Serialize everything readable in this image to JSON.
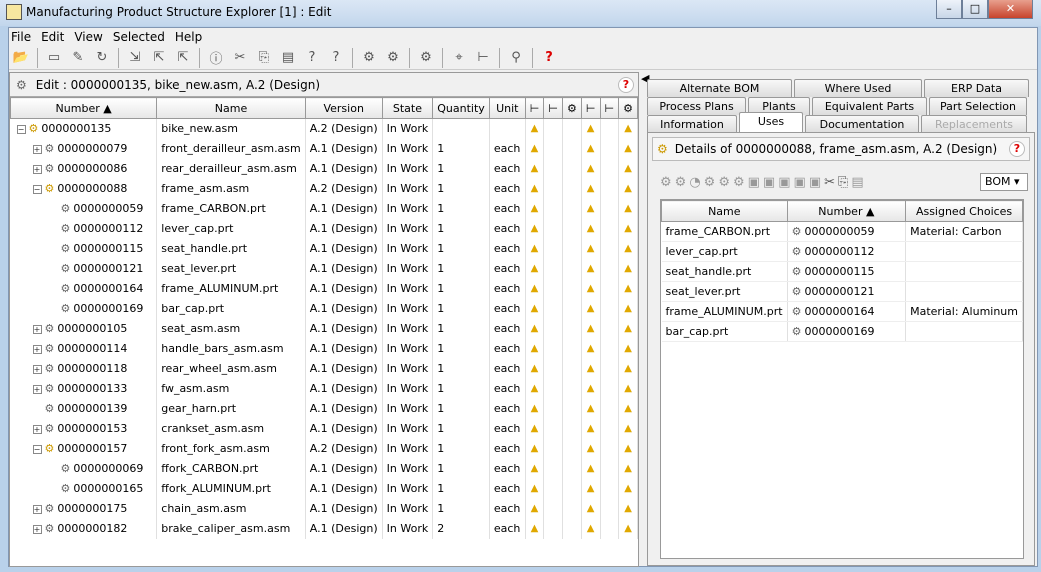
{
  "window": {
    "title": "Manufacturing Product Structure Explorer [1] : Edit"
  },
  "menu": [
    "File",
    "Edit",
    "View",
    "Selected",
    "Help"
  ],
  "toolbar_icons": [
    "open-icon",
    "folder-icon",
    "edit-icon",
    "refresh-icon",
    "check-in-icon",
    "check-out-icon",
    "undo-checkout-icon",
    "info-icon",
    "cut-icon",
    "copy-icon",
    "paste-icon",
    "help-box-icon",
    "help-box-icon",
    "insert-icon",
    "replace-icon",
    "save-icon",
    "select-icon",
    "tree-icon",
    "find-icon",
    "help-icon"
  ],
  "left": {
    "header": "Edit : 0000000135, bike_new.asm, A.2 (Design)",
    "columns": [
      "Number",
      "Name",
      "Version",
      "State",
      "Quantity",
      "Unit"
    ],
    "rows": [
      {
        "level": 0,
        "exp": "-",
        "number": "0000000135",
        "name": "bike_new.asm",
        "version": "A.2 (Design)",
        "state": "In Work",
        "qty": "",
        "unit": ""
      },
      {
        "level": 1,
        "exp": "+",
        "number": "0000000079",
        "name": "front_derailleur_asm.asm",
        "version": "A.1 (Design)",
        "state": "In Work",
        "qty": "1",
        "unit": "each"
      },
      {
        "level": 1,
        "exp": "+",
        "number": "0000000086",
        "name": "rear_derailleur_asm.asm",
        "version": "A.1 (Design)",
        "state": "In Work",
        "qty": "1",
        "unit": "each"
      },
      {
        "level": 1,
        "exp": "-",
        "number": "0000000088",
        "name": "frame_asm.asm",
        "version": "A.2 (Design)",
        "state": "In Work",
        "qty": "1",
        "unit": "each"
      },
      {
        "level": 2,
        "exp": "",
        "number": "0000000059",
        "name": "frame_CARBON.prt",
        "version": "A.1 (Design)",
        "state": "In Work",
        "qty": "1",
        "unit": "each"
      },
      {
        "level": 2,
        "exp": "",
        "number": "0000000112",
        "name": "lever_cap.prt",
        "version": "A.1 (Design)",
        "state": "In Work",
        "qty": "1",
        "unit": "each"
      },
      {
        "level": 2,
        "exp": "",
        "number": "0000000115",
        "name": "seat_handle.prt",
        "version": "A.1 (Design)",
        "state": "In Work",
        "qty": "1",
        "unit": "each"
      },
      {
        "level": 2,
        "exp": "",
        "number": "0000000121",
        "name": "seat_lever.prt",
        "version": "A.1 (Design)",
        "state": "In Work",
        "qty": "1",
        "unit": "each"
      },
      {
        "level": 2,
        "exp": "",
        "number": "0000000164",
        "name": "frame_ALUMINUM.prt",
        "version": "A.1 (Design)",
        "state": "In Work",
        "qty": "1",
        "unit": "each"
      },
      {
        "level": 2,
        "exp": "",
        "number": "0000000169",
        "name": "bar_cap.prt",
        "version": "A.1 (Design)",
        "state": "In Work",
        "qty": "1",
        "unit": "each"
      },
      {
        "level": 1,
        "exp": "+",
        "number": "0000000105",
        "name": "seat_asm.asm",
        "version": "A.1 (Design)",
        "state": "In Work",
        "qty": "1",
        "unit": "each"
      },
      {
        "level": 1,
        "exp": "+",
        "number": "0000000114",
        "name": "handle_bars_asm.asm",
        "version": "A.1 (Design)",
        "state": "In Work",
        "qty": "1",
        "unit": "each"
      },
      {
        "level": 1,
        "exp": "+",
        "number": "0000000118",
        "name": "rear_wheel_asm.asm",
        "version": "A.1 (Design)",
        "state": "In Work",
        "qty": "1",
        "unit": "each"
      },
      {
        "level": 1,
        "exp": "+",
        "number": "0000000133",
        "name": "fw_asm.asm",
        "version": "A.1 (Design)",
        "state": "In Work",
        "qty": "1",
        "unit": "each"
      },
      {
        "level": 1,
        "exp": "",
        "number": "0000000139",
        "name": "gear_harn.prt",
        "version": "A.1 (Design)",
        "state": "In Work",
        "qty": "1",
        "unit": "each"
      },
      {
        "level": 1,
        "exp": "+",
        "number": "0000000153",
        "name": "crankset_asm.asm",
        "version": "A.1 (Design)",
        "state": "In Work",
        "qty": "1",
        "unit": "each"
      },
      {
        "level": 1,
        "exp": "-",
        "number": "0000000157",
        "name": "front_fork_asm.asm",
        "version": "A.2 (Design)",
        "state": "In Work",
        "qty": "1",
        "unit": "each"
      },
      {
        "level": 2,
        "exp": "",
        "number": "0000000069",
        "name": "ffork_CARBON.prt",
        "version": "A.1 (Design)",
        "state": "In Work",
        "qty": "1",
        "unit": "each"
      },
      {
        "level": 2,
        "exp": "",
        "number": "0000000165",
        "name": "ffork_ALUMINUM.prt",
        "version": "A.1 (Design)",
        "state": "In Work",
        "qty": "1",
        "unit": "each"
      },
      {
        "level": 1,
        "exp": "+",
        "number": "0000000175",
        "name": "chain_asm.asm",
        "version": "A.1 (Design)",
        "state": "In Work",
        "qty": "1",
        "unit": "each"
      },
      {
        "level": 1,
        "exp": "+",
        "number": "0000000182",
        "name": "brake_caliper_asm.asm",
        "version": "A.1 (Design)",
        "state": "In Work",
        "qty": "2",
        "unit": "each"
      }
    ]
  },
  "right": {
    "tabs_row1": [
      "Alternate BOM",
      "Where Used",
      "ERP Data"
    ],
    "tabs_row2": [
      "Process Plans",
      "Plants",
      "Equivalent Parts",
      "Part Selection"
    ],
    "tabs_row3": [
      "Information",
      "Uses",
      "Documentation",
      "Replacements"
    ],
    "active_tab": "Uses",
    "details": "Details of 0000000088, frame_asm.asm, A.2 (Design)",
    "bom_select": "BOM",
    "columns": [
      "Name",
      "Number",
      "Assigned Choices"
    ],
    "rows": [
      {
        "name": "frame_CARBON.prt",
        "number": "0000000059",
        "choice": "Material: Carbon"
      },
      {
        "name": "lever_cap.prt",
        "number": "0000000112",
        "choice": ""
      },
      {
        "name": "seat_handle.prt",
        "number": "0000000115",
        "choice": ""
      },
      {
        "name": "seat_lever.prt",
        "number": "0000000121",
        "choice": ""
      },
      {
        "name": "frame_ALUMINUM.prt",
        "number": "0000000164",
        "choice": "Material: Aluminum"
      },
      {
        "name": "bar_cap.prt",
        "number": "0000000169",
        "choice": ""
      }
    ]
  }
}
